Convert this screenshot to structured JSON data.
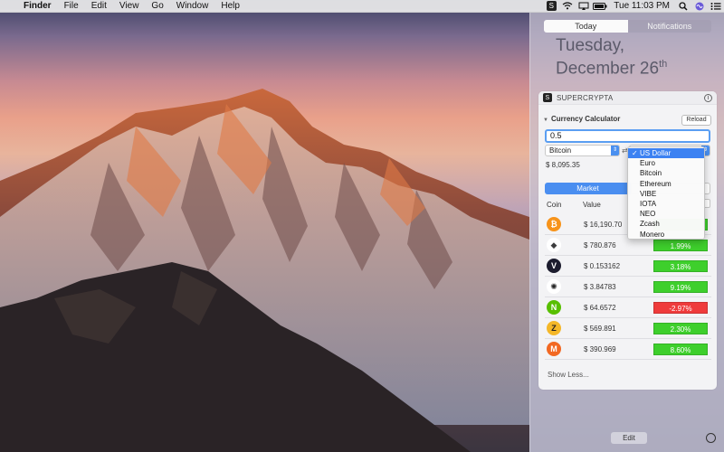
{
  "menubar": {
    "apple": "",
    "app": "Finder",
    "items": [
      "File",
      "Edit",
      "View",
      "Go",
      "Window",
      "Help"
    ],
    "clock": "Tue 11:03 PM",
    "status_icons": [
      "supercrypta-icon",
      "wifi-icon",
      "airplay-icon",
      "battery-icon",
      "search-icon",
      "siri-icon",
      "notification-center-icon"
    ]
  },
  "notification_center": {
    "tabs": [
      "Today",
      "Notifications"
    ],
    "date_line1": "Tuesday,",
    "date_line2": "December 26",
    "date_suffix": "th",
    "edit_label": "Edit"
  },
  "widget": {
    "title": "SUPERCRYPTA",
    "info": "i",
    "calculator_title": "Currency Calculator",
    "reload_label": "Reload",
    "amount": "0.5",
    "from_currency": "Bitcoin",
    "result": "$ 8,095.35",
    "market_label": "Market",
    "col_coin": "Coin",
    "col_value": "Value",
    "show_less": "Show Less...",
    "rows": [
      {
        "icon": "bitcoin-icon",
        "symbol": "₿",
        "color": "#f7931a",
        "value": "$ 16,190.70",
        "change": "",
        "dir": "up"
      },
      {
        "icon": "ethereum-icon",
        "symbol": "◆",
        "color": "#ffffff",
        "value": "$ 780.876",
        "change": "1.99%",
        "dir": "up"
      },
      {
        "icon": "vibe-icon",
        "symbol": "V",
        "color": "#1c1c2e",
        "value": "$ 0.153162",
        "change": "3.18%",
        "dir": "up"
      },
      {
        "icon": "iota-icon",
        "symbol": "✺",
        "color": "#ffffff",
        "value": "$ 3.84783",
        "change": "9.19%",
        "dir": "up"
      },
      {
        "icon": "neo-icon",
        "symbol": "N",
        "color": "#58bf00",
        "value": "$ 64.6572",
        "change": "-2.97%",
        "dir": "down"
      },
      {
        "icon": "zcash-icon",
        "symbol": "Z",
        "color": "#f4b728",
        "value": "$ 569.891",
        "change": "2.30%",
        "dir": "up"
      },
      {
        "icon": "monero-icon",
        "symbol": "M",
        "color": "#f26822",
        "value": "$ 390.969",
        "change": "8.60%",
        "dir": "up"
      }
    ]
  },
  "dropdown": {
    "selected": "US Dollar",
    "checkmark": "✓",
    "options": [
      "Euro",
      "Bitcoin",
      "Ethereum",
      "VIBE",
      "IOTA",
      "NEO",
      "Zcash",
      "Monero"
    ]
  },
  "colors": {
    "accent": "#4a8ef0",
    "positive": "#3ecf2c",
    "negative": "#ef3b3b"
  }
}
